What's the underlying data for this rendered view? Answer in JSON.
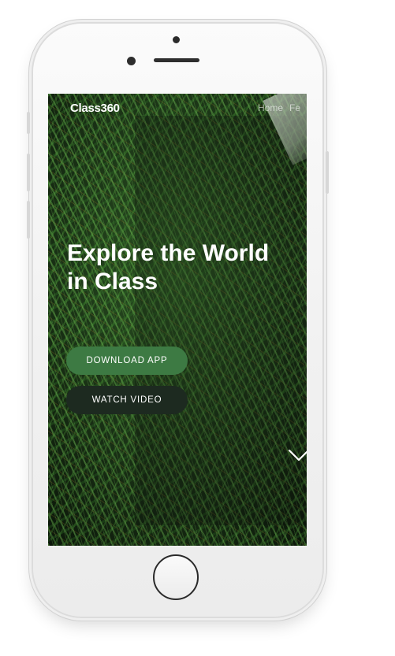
{
  "app": {
    "brand": "Class360",
    "nav": [
      {
        "label": "Home"
      },
      {
        "label": "Fe"
      }
    ]
  },
  "hero": {
    "title_line1": "Explore the World",
    "title_line2": "in Class",
    "download_label": "DOWNLOAD APP",
    "watch_label": "WATCH VIDEO"
  },
  "icons": {
    "scroll": "chevron-down-icon"
  },
  "colors": {
    "download_button": "#3d7a43",
    "watch_button": "#1d2a20",
    "text": "#ffffff"
  }
}
